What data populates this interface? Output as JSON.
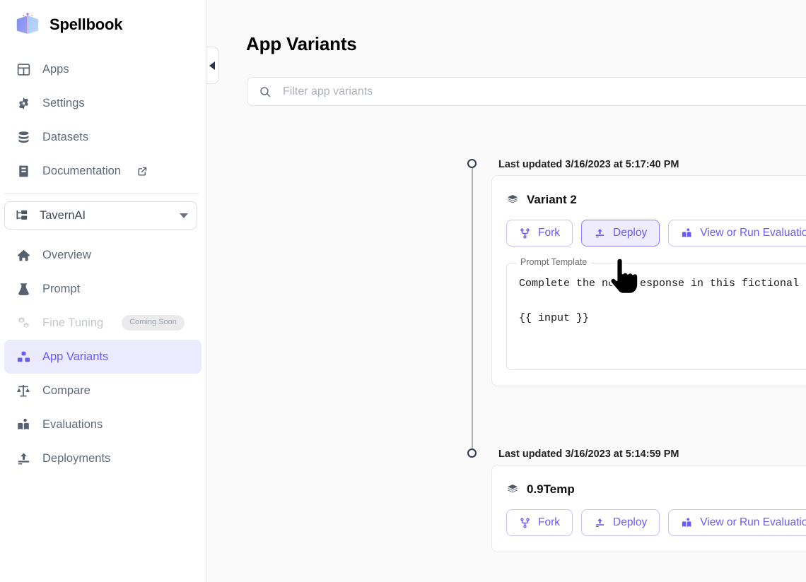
{
  "brand": {
    "name": "Spellbook",
    "logo_icon": "spellbook-book-icon"
  },
  "sidebar": {
    "top_items": [
      {
        "label": "Apps",
        "icon": "grid-icon",
        "state": "default"
      },
      {
        "label": "Settings",
        "icon": "gear-icon",
        "state": "default"
      },
      {
        "label": "Datasets",
        "icon": "database-icon",
        "state": "default"
      },
      {
        "label": "Documentation",
        "icon": "book-icon",
        "state": "default",
        "external": true,
        "external_icon": "external-link-icon"
      }
    ],
    "app_selector": {
      "value": "TavernAI",
      "icon": "hierarchy-icon",
      "caret_icon": "chevron-down-icon"
    },
    "app_items": [
      {
        "label": "Overview",
        "icon": "home-icon",
        "state": "default"
      },
      {
        "label": "Prompt",
        "icon": "flask-icon",
        "state": "default"
      },
      {
        "label": "Fine Tuning",
        "icon": "cogs-icon",
        "state": "disabled",
        "badge": "Coming Soon"
      },
      {
        "label": "App Variants",
        "icon": "blocks-icon",
        "state": "active"
      },
      {
        "label": "Compare",
        "icon": "scales-icon",
        "state": "default"
      },
      {
        "label": "Evaluations",
        "icon": "open-book-icon",
        "state": "default"
      },
      {
        "label": "Deployments",
        "icon": "upload-icon",
        "state": "default"
      }
    ]
  },
  "main": {
    "collapse_button_icon": "chevron-left-icon",
    "page_title": "App Variants",
    "search": {
      "placeholder": "Filter app variants",
      "value": "",
      "icon": "search-icon"
    },
    "variants": [
      {
        "timestamp": "Last updated 3/16/2023 at 5:17:40 PM",
        "name": "Variant 2",
        "name_icon": "layers-icon",
        "buttons": [
          {
            "label": "Fork",
            "icon": "fork-icon",
            "hovered": false
          },
          {
            "label": "Deploy",
            "icon": "deploy-upload-icon",
            "hovered": true
          },
          {
            "label": "View or Run Evaluations",
            "icon": "open-book-icon",
            "hovered": false
          }
        ],
        "prompt_template": {
          "legend": "Prompt Template",
          "text": "Complete the next response in this fictional roleplay chat.\n\n{{ input }}"
        }
      },
      {
        "timestamp": "Last updated 3/16/2023 at 5:14:59 PM",
        "name": "0.9Temp",
        "name_icon": "layers-icon",
        "buttons": [
          {
            "label": "Fork",
            "icon": "fork-icon",
            "hovered": false
          },
          {
            "label": "Deploy",
            "icon": "deploy-upload-icon",
            "hovered": false
          },
          {
            "label": "View or Run Evaluations",
            "icon": "open-book-icon",
            "hovered": false
          }
        ],
        "prompt_template": null
      }
    ]
  },
  "cursor": {
    "type": "pointing-hand-cursor"
  },
  "colors": {
    "accent": "#6a5cf5",
    "accent_bg": "#eceafd",
    "sidebar_text": "#5e6a7a",
    "page_bg": "#fafafa",
    "card_bg": "#ffffff",
    "border": "#e8e8e8",
    "timeline": "#2e3b50"
  }
}
